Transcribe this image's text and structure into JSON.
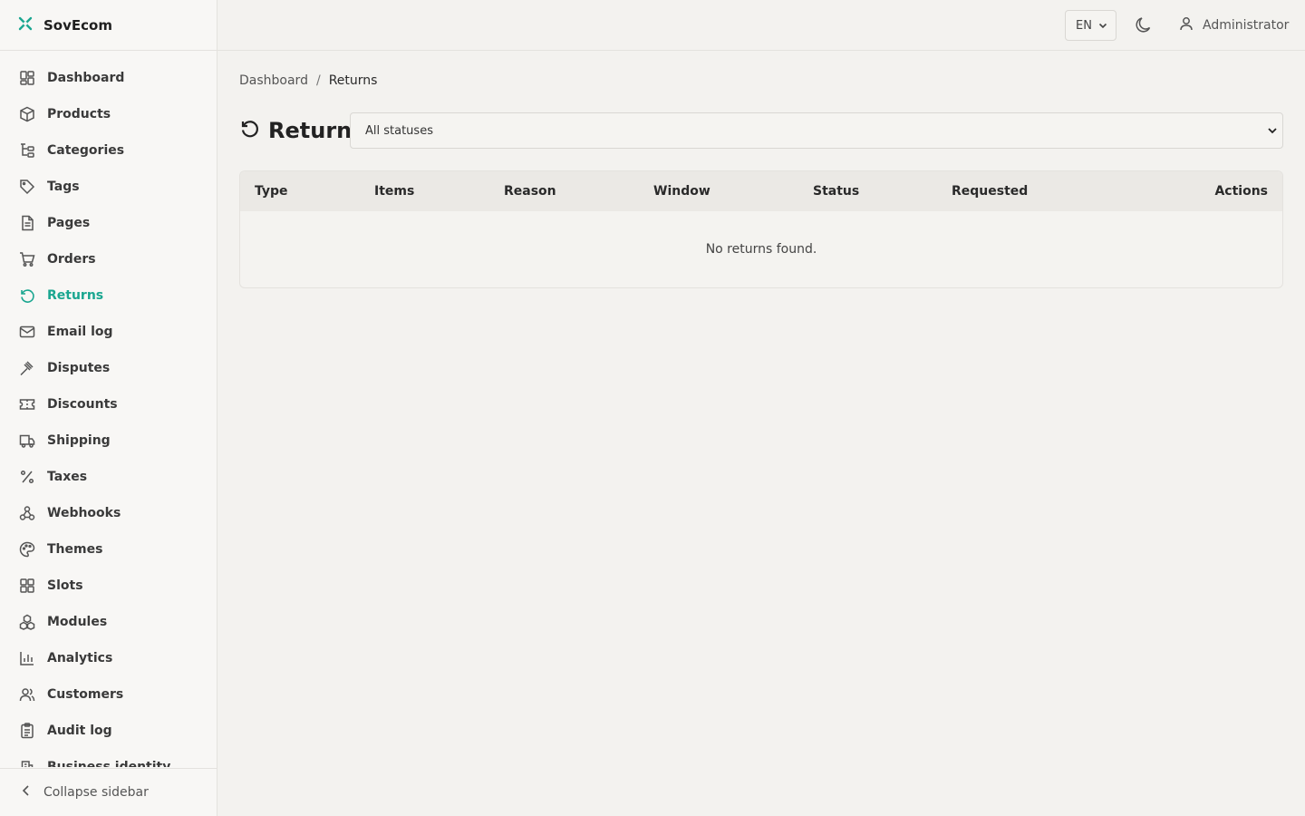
{
  "brand": {
    "name": "SovEcom",
    "accent": "#1aa690"
  },
  "sidebar": {
    "items": [
      {
        "label": "Dashboard",
        "icon": "dashboard-icon"
      },
      {
        "label": "Products",
        "icon": "box-icon"
      },
      {
        "label": "Categories",
        "icon": "tree-icon"
      },
      {
        "label": "Tags",
        "icon": "tag-icon"
      },
      {
        "label": "Pages",
        "icon": "file-icon"
      },
      {
        "label": "Orders",
        "icon": "cart-icon"
      },
      {
        "label": "Returns",
        "icon": "rotate-ccw-icon",
        "active": true
      },
      {
        "label": "Email log",
        "icon": "mail-icon"
      },
      {
        "label": "Disputes",
        "icon": "gavel-icon"
      },
      {
        "label": "Discounts",
        "icon": "ticket-icon"
      },
      {
        "label": "Shipping",
        "icon": "truck-icon"
      },
      {
        "label": "Taxes",
        "icon": "percent-icon"
      },
      {
        "label": "Webhooks",
        "icon": "webhook-icon"
      },
      {
        "label": "Themes",
        "icon": "palette-icon"
      },
      {
        "label": "Slots",
        "icon": "grid-icon"
      },
      {
        "label": "Modules",
        "icon": "boxes-icon"
      },
      {
        "label": "Analytics",
        "icon": "bar-chart-icon"
      },
      {
        "label": "Customers",
        "icon": "users-icon"
      },
      {
        "label": "Audit log",
        "icon": "clipboard-icon"
      },
      {
        "label": "Business identity",
        "icon": "building-icon"
      }
    ],
    "collapse_label": "Collapse sidebar"
  },
  "header": {
    "language": "EN",
    "user": "Administrator"
  },
  "breadcrumb": {
    "root": "Dashboard",
    "separator": "/",
    "current": "Returns"
  },
  "page": {
    "title": "Returns",
    "status_filter": "All statuses"
  },
  "table": {
    "columns": [
      "Type",
      "Items",
      "Reason",
      "Window",
      "Status",
      "Requested",
      "Actions"
    ],
    "empty_message": "No returns found."
  }
}
